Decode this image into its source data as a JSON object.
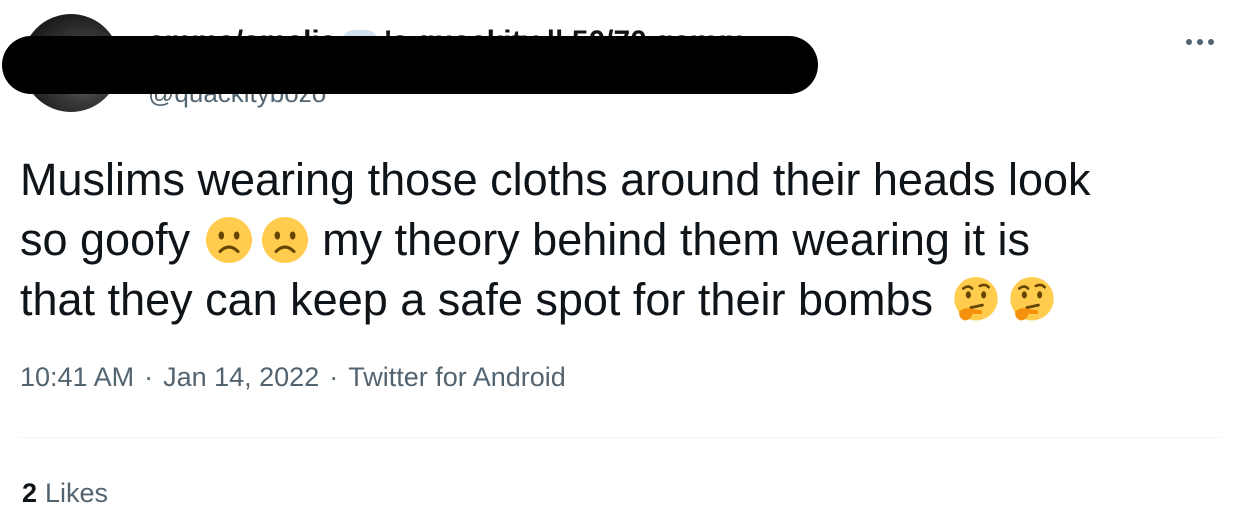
{
  "author": {
    "display_name_start": "emma/amelia",
    "display_name_end": "'s quackity || 50/70 ganyu",
    "handle": "@quackitybozo",
    "avatar_icon": "avatar-photo"
  },
  "more_icon": "ellipsis-icon",
  "tweet": {
    "line1": "Muslims wearing those cloths around their heads look",
    "line2_start": "so goofy",
    "line2_end": "my theory behind them wearing it is",
    "line3": "that they can keep a safe spot for their bombs",
    "emoji_frown": "frowning-face-emoji",
    "emoji_thinking": "thinking-face-emoji"
  },
  "meta": {
    "time": "10:41 AM",
    "sep1": "·",
    "date": "Jan 14, 2022",
    "sep2": "·",
    "source": "Twitter for Android"
  },
  "stats": {
    "likes_count": "2",
    "likes_label": "Likes"
  },
  "colors": {
    "text_primary": "#0f1419",
    "text_secondary": "#536471",
    "divider": "#eff3f4",
    "emoji_yellow": "#ffcc4d",
    "emoji_feature": "#664500",
    "hand": "#f4900c"
  }
}
